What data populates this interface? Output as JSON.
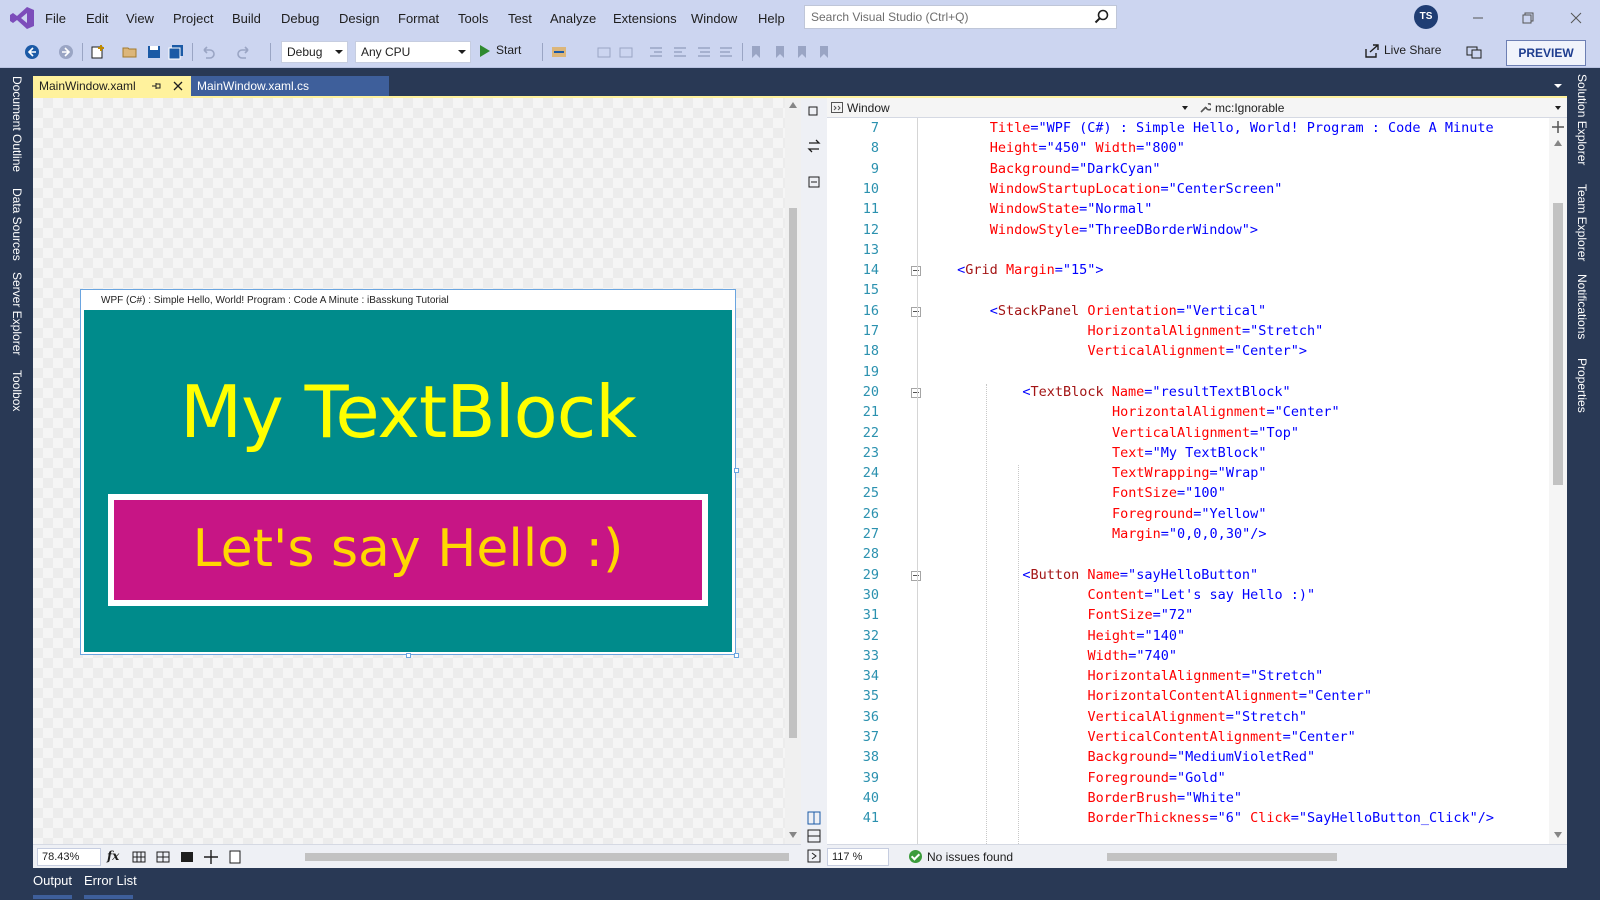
{
  "menu": {
    "items": [
      "File",
      "Edit",
      "View",
      "Project",
      "Build",
      "Debug",
      "Design",
      "Format",
      "Tools",
      "Test",
      "Analyze",
      "Extensions",
      "Window",
      "Help"
    ]
  },
  "search": {
    "placeholder": "Search Visual Studio (Ctrl+Q)"
  },
  "account": {
    "initials": "TS"
  },
  "toolbar": {
    "configuration": "Debug",
    "platform": "Any CPU",
    "start_label": "Start",
    "live_share_label": "Live Share",
    "preview_label": "PREVIEW"
  },
  "side_panels": {
    "left": [
      "Document Outline",
      "Data Sources",
      "Server Explorer",
      "Toolbox"
    ],
    "right": [
      "Solution Explorer",
      "Team Explorer",
      "Notifications",
      "Properties"
    ]
  },
  "tabs": {
    "active": "MainWindow.xaml",
    "inactive": "MainWindow.xaml.cs"
  },
  "designer": {
    "window_title": "WPF (C#) : Simple Hello, World! Program : Code A Minute : iBasskung Tutorial",
    "textblock_text": "My TextBlock",
    "button_text": "Let's say Hello :)",
    "zoom": "78.43%",
    "fx_label": "fx",
    "colors": {
      "background": "#008B8B",
      "textblock_fg": "#FFFF00",
      "button_bg": "#C71585",
      "button_fg": "#FFD700",
      "button_border": "#FFFFFF"
    }
  },
  "editor": {
    "element_selector": "Window",
    "member_selector": "mc:Ignorable",
    "zoom": "117 %",
    "status": "No issues found",
    "lines": [
      {
        "n": "7",
        "indent": 5,
        "tokens": [
          [
            "a",
            "Title"
          ],
          [
            "p",
            "=\""
          ],
          [
            "v",
            "WPF (C#) : Simple Hello, World! Program : Code A Minute"
          ]
        ]
      },
      {
        "n": "8",
        "indent": 5,
        "tokens": [
          [
            "a",
            "Height"
          ],
          [
            "p",
            "=\""
          ],
          [
            "v",
            "450"
          ],
          [
            "p",
            "\" "
          ],
          [
            "a",
            "Width"
          ],
          [
            "p",
            "=\""
          ],
          [
            "v",
            "800"
          ],
          [
            "p",
            "\""
          ]
        ]
      },
      {
        "n": "9",
        "indent": 5,
        "tokens": [
          [
            "a",
            "Background"
          ],
          [
            "p",
            "=\""
          ],
          [
            "v",
            "DarkCyan"
          ],
          [
            "p",
            "\""
          ]
        ]
      },
      {
        "n": "10",
        "indent": 5,
        "tokens": [
          [
            "a",
            "WindowStartupLocation"
          ],
          [
            "p",
            "=\""
          ],
          [
            "v",
            "CenterScreen"
          ],
          [
            "p",
            "\""
          ]
        ]
      },
      {
        "n": "11",
        "indent": 5,
        "tokens": [
          [
            "a",
            "WindowState"
          ],
          [
            "p",
            "=\""
          ],
          [
            "v",
            "Normal"
          ],
          [
            "p",
            "\""
          ]
        ]
      },
      {
        "n": "12",
        "indent": 5,
        "tokens": [
          [
            "a",
            "WindowStyle"
          ],
          [
            "p",
            "=\""
          ],
          [
            "v",
            "ThreeDBorderWindow"
          ],
          [
            "p",
            "\">"
          ]
        ]
      },
      {
        "n": "13",
        "indent": 0,
        "tokens": []
      },
      {
        "n": "14",
        "indent": 1,
        "tokens": [
          [
            "p",
            "<"
          ],
          [
            "t",
            "Grid"
          ],
          [
            "p",
            " "
          ],
          [
            "a",
            "Margin"
          ],
          [
            "p",
            "=\""
          ],
          [
            "v",
            "15"
          ],
          [
            "p",
            "\">"
          ]
        ]
      },
      {
        "n": "15",
        "indent": 0,
        "tokens": []
      },
      {
        "n": "16",
        "indent": 5,
        "tokens": [
          [
            "p",
            "<"
          ],
          [
            "t",
            "StackPanel"
          ],
          [
            "p",
            " "
          ],
          [
            "a",
            "Orientation"
          ],
          [
            "p",
            "=\""
          ],
          [
            "v",
            "Vertical"
          ],
          [
            "p",
            "\""
          ]
        ]
      },
      {
        "n": "17",
        "indent": 17,
        "tokens": [
          [
            "a",
            "HorizontalAlignment"
          ],
          [
            "p",
            "=\""
          ],
          [
            "v",
            "Stretch"
          ],
          [
            "p",
            "\""
          ]
        ]
      },
      {
        "n": "18",
        "indent": 17,
        "tokens": [
          [
            "a",
            "VerticalAlignment"
          ],
          [
            "p",
            "=\""
          ],
          [
            "v",
            "Center"
          ],
          [
            "p",
            "\">"
          ]
        ]
      },
      {
        "n": "19",
        "indent": 0,
        "tokens": []
      },
      {
        "n": "20",
        "indent": 9,
        "tokens": [
          [
            "p",
            "<"
          ],
          [
            "t",
            "TextBlock"
          ],
          [
            "p",
            " "
          ],
          [
            "a",
            "Name"
          ],
          [
            "p",
            "=\""
          ],
          [
            "v",
            "resultTextBlock"
          ],
          [
            "p",
            "\""
          ]
        ]
      },
      {
        "n": "21",
        "indent": 20,
        "tokens": [
          [
            "a",
            "HorizontalAlignment"
          ],
          [
            "p",
            "=\""
          ],
          [
            "v",
            "Center"
          ],
          [
            "p",
            "\""
          ]
        ]
      },
      {
        "n": "22",
        "indent": 20,
        "tokens": [
          [
            "a",
            "VerticalAlignment"
          ],
          [
            "p",
            "=\""
          ],
          [
            "v",
            "Top"
          ],
          [
            "p",
            "\""
          ]
        ]
      },
      {
        "n": "23",
        "indent": 20,
        "tokens": [
          [
            "a",
            "Text"
          ],
          [
            "p",
            "=\""
          ],
          [
            "v",
            "My TextBlock"
          ],
          [
            "p",
            "\""
          ]
        ]
      },
      {
        "n": "24",
        "indent": 20,
        "tokens": [
          [
            "a",
            "TextWrapping"
          ],
          [
            "p",
            "=\""
          ],
          [
            "v",
            "Wrap"
          ],
          [
            "p",
            "\""
          ]
        ]
      },
      {
        "n": "25",
        "indent": 20,
        "tokens": [
          [
            "a",
            "FontSize"
          ],
          [
            "p",
            "=\""
          ],
          [
            "v",
            "100"
          ],
          [
            "p",
            "\""
          ]
        ]
      },
      {
        "n": "26",
        "indent": 20,
        "tokens": [
          [
            "a",
            "Foreground"
          ],
          [
            "p",
            "=\""
          ],
          [
            "v",
            "Yellow"
          ],
          [
            "p",
            "\""
          ]
        ]
      },
      {
        "n": "27",
        "indent": 20,
        "tokens": [
          [
            "a",
            "Margin"
          ],
          [
            "p",
            "=\""
          ],
          [
            "v",
            "0,0,0,30"
          ],
          [
            "p",
            "\"/>"
          ]
        ]
      },
      {
        "n": "28",
        "indent": 0,
        "tokens": []
      },
      {
        "n": "29",
        "indent": 9,
        "tokens": [
          [
            "p",
            "<"
          ],
          [
            "t",
            "Button"
          ],
          [
            "p",
            " "
          ],
          [
            "a",
            "Name"
          ],
          [
            "p",
            "=\""
          ],
          [
            "v",
            "sayHelloButton"
          ],
          [
            "p",
            "\""
          ]
        ]
      },
      {
        "n": "30",
        "indent": 17,
        "tokens": [
          [
            "a",
            "Content"
          ],
          [
            "p",
            "=\""
          ],
          [
            "v",
            "Let's say Hello :)"
          ],
          [
            "p",
            "\""
          ]
        ]
      },
      {
        "n": "31",
        "indent": 17,
        "tokens": [
          [
            "a",
            "FontSize"
          ],
          [
            "p",
            "=\""
          ],
          [
            "v",
            "72"
          ],
          [
            "p",
            "\""
          ]
        ]
      },
      {
        "n": "32",
        "indent": 17,
        "tokens": [
          [
            "a",
            "Height"
          ],
          [
            "p",
            "=\""
          ],
          [
            "v",
            "140"
          ],
          [
            "p",
            "\""
          ]
        ]
      },
      {
        "n": "33",
        "indent": 17,
        "tokens": [
          [
            "a",
            "Width"
          ],
          [
            "p",
            "=\""
          ],
          [
            "v",
            "740"
          ],
          [
            "p",
            "\""
          ]
        ]
      },
      {
        "n": "34",
        "indent": 17,
        "tokens": [
          [
            "a",
            "HorizontalAlignment"
          ],
          [
            "p",
            "=\""
          ],
          [
            "v",
            "Stretch"
          ],
          [
            "p",
            "\""
          ]
        ]
      },
      {
        "n": "35",
        "indent": 17,
        "tokens": [
          [
            "a",
            "HorizontalContentAlignment"
          ],
          [
            "p",
            "=\""
          ],
          [
            "v",
            "Center"
          ],
          [
            "p",
            "\""
          ]
        ]
      },
      {
        "n": "36",
        "indent": 17,
        "tokens": [
          [
            "a",
            "VerticalAlignment"
          ],
          [
            "p",
            "=\""
          ],
          [
            "v",
            "Stretch"
          ],
          [
            "p",
            "\""
          ]
        ]
      },
      {
        "n": "37",
        "indent": 17,
        "tokens": [
          [
            "a",
            "VerticalContentAlignment"
          ],
          [
            "p",
            "=\""
          ],
          [
            "v",
            "Center"
          ],
          [
            "p",
            "\""
          ]
        ]
      },
      {
        "n": "38",
        "indent": 17,
        "tokens": [
          [
            "a",
            "Background"
          ],
          [
            "p",
            "=\""
          ],
          [
            "v",
            "MediumVioletRed"
          ],
          [
            "p",
            "\""
          ]
        ]
      },
      {
        "n": "39",
        "indent": 17,
        "tokens": [
          [
            "a",
            "Foreground"
          ],
          [
            "p",
            "=\""
          ],
          [
            "v",
            "Gold"
          ],
          [
            "p",
            "\""
          ]
        ]
      },
      {
        "n": "40",
        "indent": 17,
        "tokens": [
          [
            "a",
            "BorderBrush"
          ],
          [
            "p",
            "=\""
          ],
          [
            "v",
            "White"
          ],
          [
            "p",
            "\""
          ]
        ]
      },
      {
        "n": "41",
        "indent": 17,
        "tokens": [
          [
            "a",
            "BorderThickness"
          ],
          [
            "p",
            "=\""
          ],
          [
            "v",
            "6"
          ],
          [
            "p",
            "\" "
          ],
          [
            "a",
            "Click"
          ],
          [
            "p",
            "=\""
          ],
          [
            "v",
            "SayHelloButton_Click"
          ],
          [
            "p",
            "\"/>"
          ]
        ]
      }
    ]
  },
  "bottom_tabs": [
    "Output",
    "Error List"
  ],
  "icons": [
    "visual-studio-logo-icon",
    "search-icon",
    "back-icon",
    "forward-icon",
    "new-project-icon",
    "open-folder-icon",
    "save-icon",
    "save-all-icon",
    "undo-icon",
    "redo-icon",
    "play-icon",
    "live-share-icon",
    "feedback-icon",
    "minimize-icon",
    "restore-icon",
    "close-icon",
    "pin-icon",
    "tab-close-icon",
    "check-circle-icon"
  ],
  "colors": {
    "accent_tab": "#FFF29D",
    "chrome": "#CCD5F0",
    "frame": "#293955"
  }
}
